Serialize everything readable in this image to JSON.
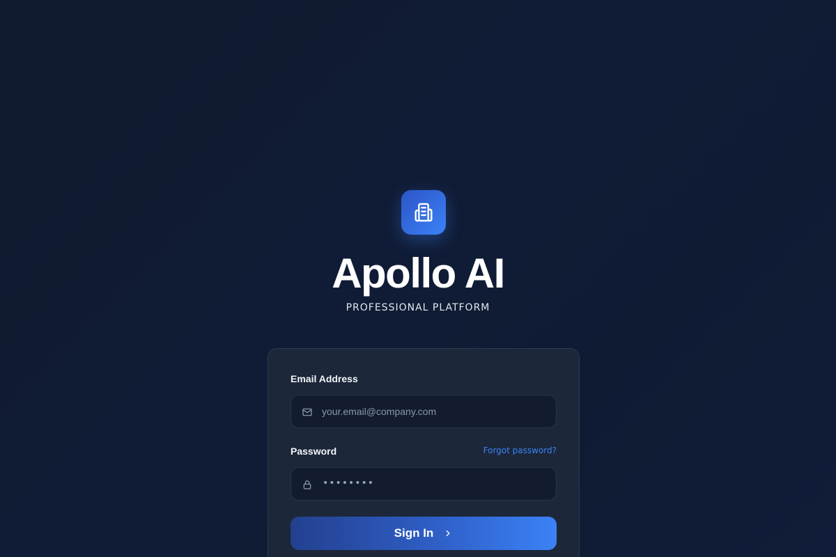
{
  "brand": {
    "icon": "building-icon",
    "title": "Apollo AI",
    "subtitle": "PROFESSIONAL PLATFORM"
  },
  "login": {
    "email_label": "Email Address",
    "email_placeholder": "your.email@company.com",
    "email_icon": "mail-icon",
    "password_label": "Password",
    "forgot_link": "Forgot password?",
    "password_icon": "lock-icon",
    "password_masked": "••••••••",
    "submit_label": "Sign In",
    "submit_icon": "chevron-right-icon"
  },
  "colors": {
    "background": "#0f1a2e",
    "card": "#1c2739",
    "accent": "#3b82f6",
    "accent_dark": "#23408f"
  }
}
